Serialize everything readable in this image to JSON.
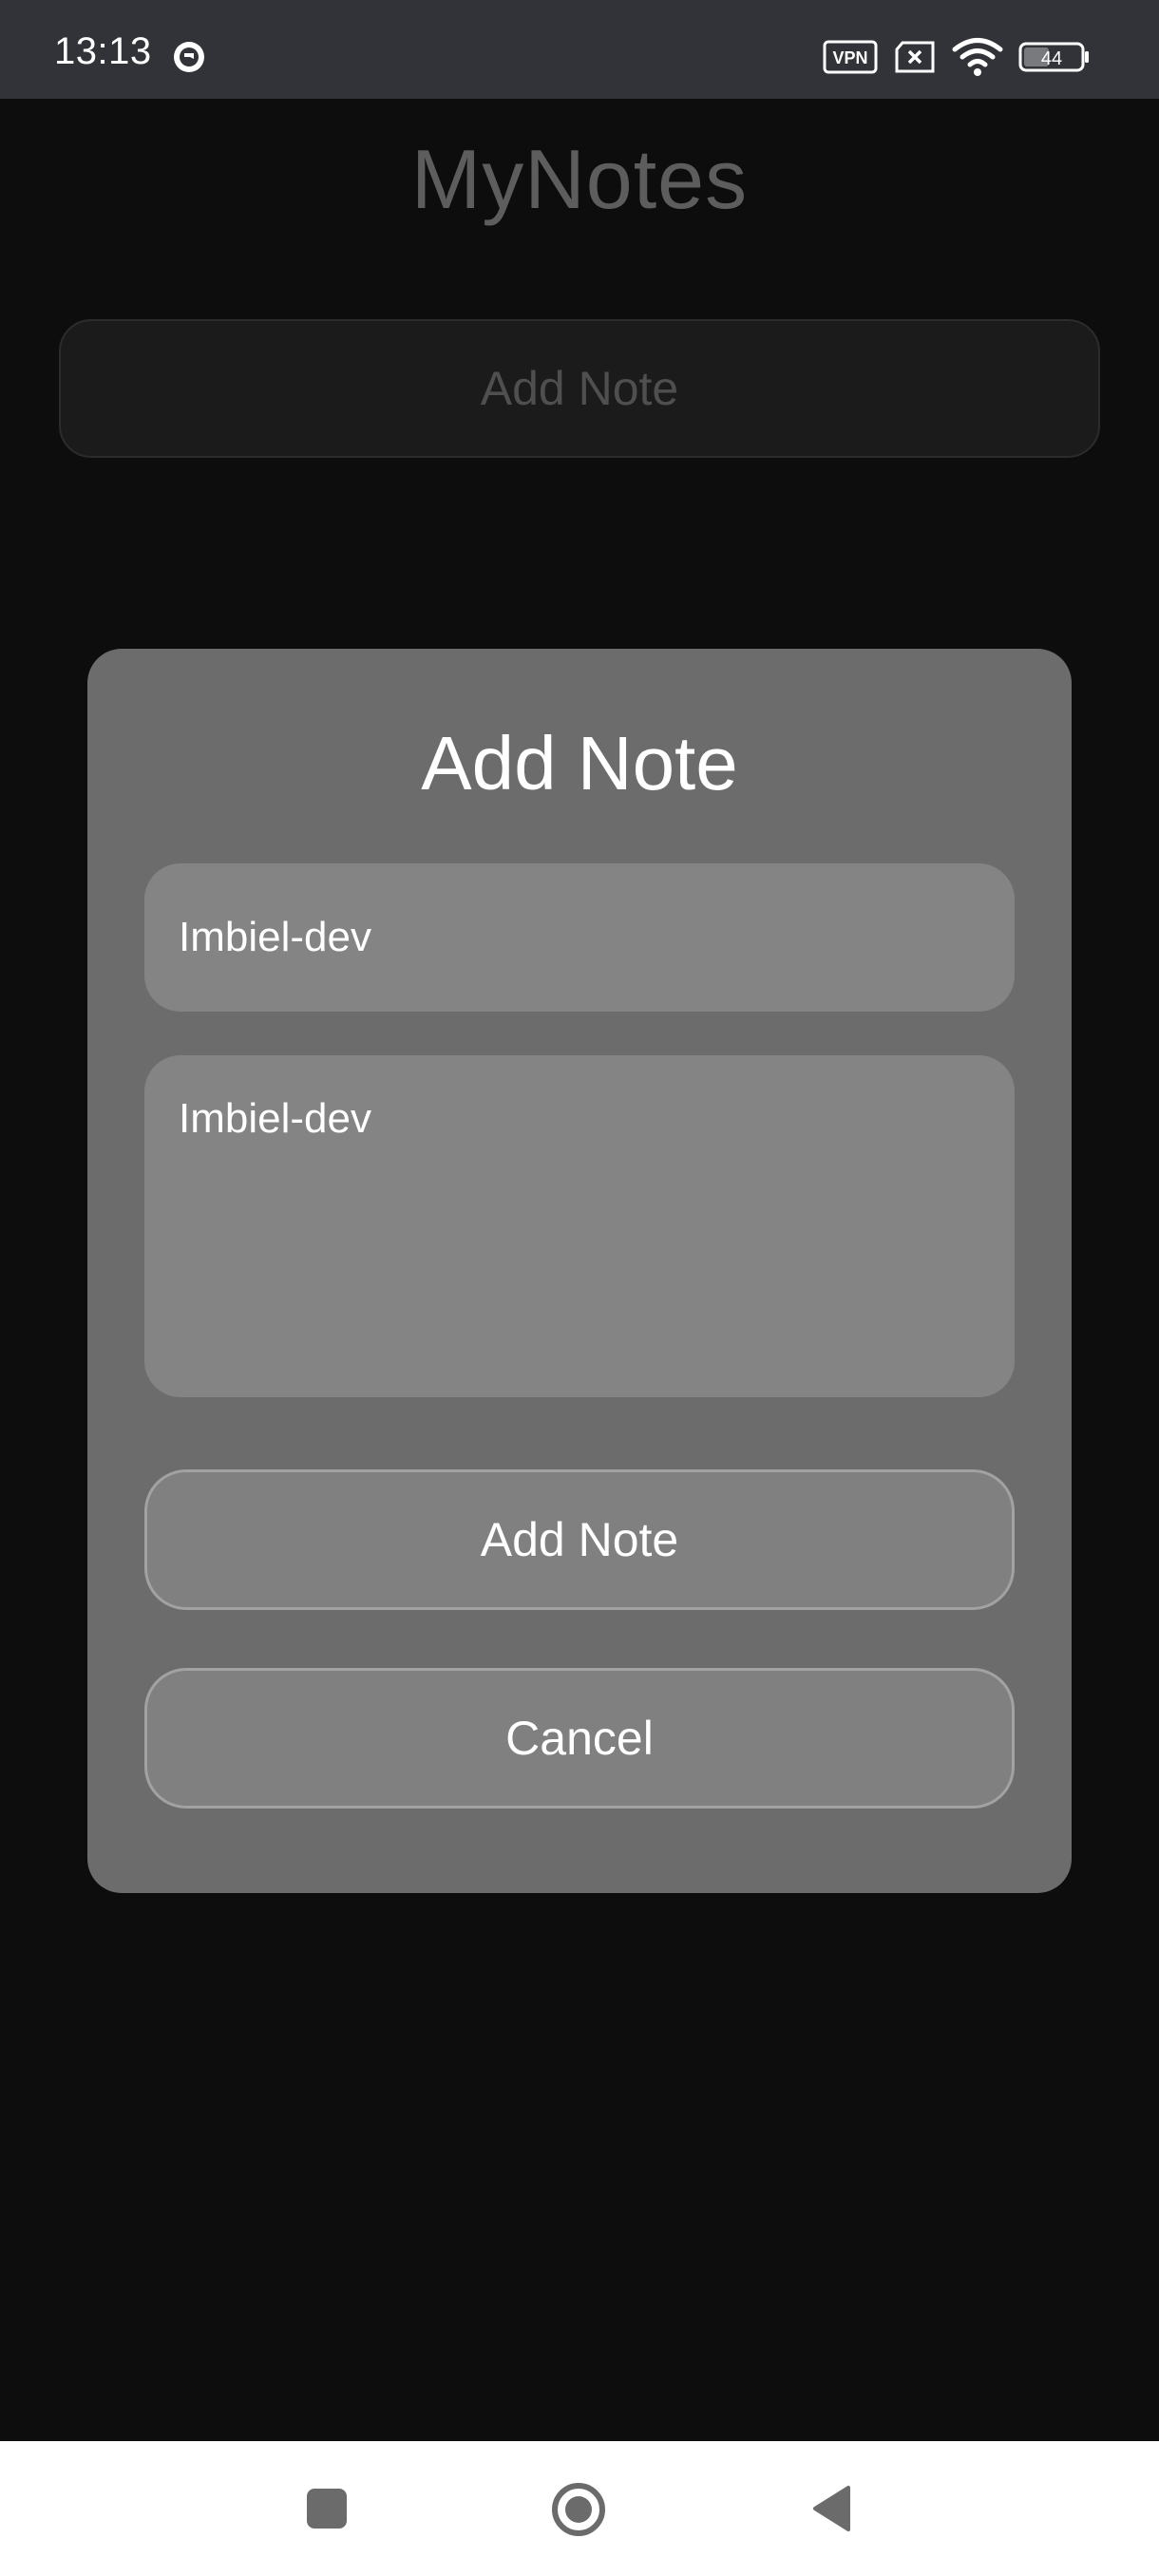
{
  "status_bar": {
    "time": "13:13",
    "vpn_label": "VPN",
    "battery_level": "44",
    "icons": [
      "vpn-icon",
      "no-sim-icon",
      "wifi-icon",
      "battery-icon"
    ]
  },
  "app": {
    "title": "MyNotes",
    "add_note_button": "Add Note"
  },
  "dialog": {
    "title": "Add Note",
    "title_field_value": "Imbiel-dev",
    "content_field_value": "Imbiel-dev",
    "add_button": "Add Note",
    "cancel_button": "Cancel"
  },
  "nav_bar": {
    "icons": [
      "recents-square-icon",
      "home-circle-icon",
      "back-triangle-icon"
    ]
  },
  "colors": {
    "background": "#0d0d0e",
    "status_bar": "#323338",
    "dialog": "#6c6c6c",
    "field": "#848484",
    "nav_bar": "#ffffff"
  }
}
